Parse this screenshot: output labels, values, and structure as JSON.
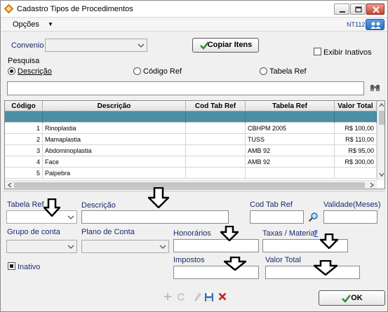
{
  "window": {
    "title": "Cadastro Tipos de Procedimentos"
  },
  "menu": {
    "opcoes_label": "Opções",
    "code": "NT112"
  },
  "header": {
    "convenio_label": "Convenio",
    "convenio_value": "",
    "copiar_label": "Copiar Itens",
    "exibir_inativos_label": "Exibir Inativos"
  },
  "pesquisa": {
    "label": "Pesquisa",
    "options": [
      "Descrição",
      "Código Ref",
      "Tabela Ref"
    ],
    "selected": "Descrição",
    "search_value": ""
  },
  "grid": {
    "columns": [
      "Código",
      "Descrição",
      "Cod Tab Ref",
      "Tabela Ref",
      "Valor Total"
    ],
    "rows": [
      {
        "codigo": "1",
        "descricao": "Rinoplastia",
        "cod_tab_ref": "",
        "tabela_ref": "CBHPM 2005",
        "valor_total": "R$ 100,00"
      },
      {
        "codigo": "2",
        "descricao": "Mamaplastia",
        "cod_tab_ref": "",
        "tabela_ref": "TUSS",
        "valor_total": "R$ 110,00"
      },
      {
        "codigo": "3",
        "descricao": "Abdominoplastia",
        "cod_tab_ref": "",
        "tabela_ref": "AMB 92",
        "valor_total": "R$ 95,00"
      },
      {
        "codigo": "4",
        "descricao": "Face",
        "cod_tab_ref": "",
        "tabela_ref": "AMB 92",
        "valor_total": "R$ 300,00"
      },
      {
        "codigo": "5",
        "descricao": "Palpebra",
        "cod_tab_ref": "",
        "tabela_ref": "",
        "valor_total": ""
      }
    ]
  },
  "form": {
    "tabela_ref_label": "Tabela Ref",
    "descricao_label": "Descrição",
    "cod_tab_ref_label": "Cod Tab Ref",
    "validade_label": "Validade(Meses)",
    "grupo_conta_label": "Grupo de conta",
    "plano_conta_label": "Plano de Conta",
    "honorarios_label": "Honorários",
    "taxas_label": "Taxas / Material",
    "taxas_help": "?",
    "impostos_label": "Impostos",
    "valor_total_label": "Valor Total",
    "inativo_label": "Inativo"
  },
  "footer": {
    "ok_label": "OK"
  },
  "colors": {
    "selected_row": "#4b8fa4",
    "label_blue": "#1c2a6b",
    "ok_green": "#2e8b2e",
    "delete_red": "#c62020"
  },
  "icons": [
    "app-icon",
    "minimize-icon",
    "maximize-icon",
    "close-icon",
    "user-icon",
    "check-icon",
    "binoculars-icon",
    "magnifier-icon",
    "add-icon",
    "refresh-icon",
    "edit-icon",
    "save-icon",
    "delete-icon",
    "down-arrow-annotation-icon"
  ]
}
